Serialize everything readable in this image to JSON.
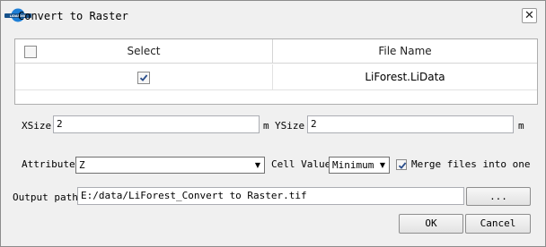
{
  "window": {
    "title": "Convert to Raster",
    "logo_text": "LiDAR360"
  },
  "table": {
    "columns": {
      "select": "Select",
      "file_name": "File Name"
    },
    "select_all_checked": false,
    "rows": [
      {
        "checked": true,
        "file_name": "LiForest.LiData"
      }
    ]
  },
  "size": {
    "xsize_label": "XSize",
    "xsize_value": "2",
    "xsize_unit": "m",
    "ysize_label": "YSize",
    "ysize_value": "2",
    "ysize_unit": "m"
  },
  "options": {
    "attribute_label": "Attribute",
    "attribute_value": "Z",
    "cell_value_label": "Cell Value",
    "cell_value_value": "Minimum",
    "merge_label": "Merge files into one",
    "merge_checked": true
  },
  "output": {
    "label": "Output path:",
    "value": "E:/data/LiForest_Convert to Raster.tif",
    "browse_label": "..."
  },
  "buttons": {
    "ok": "OK",
    "cancel": "Cancel"
  }
}
